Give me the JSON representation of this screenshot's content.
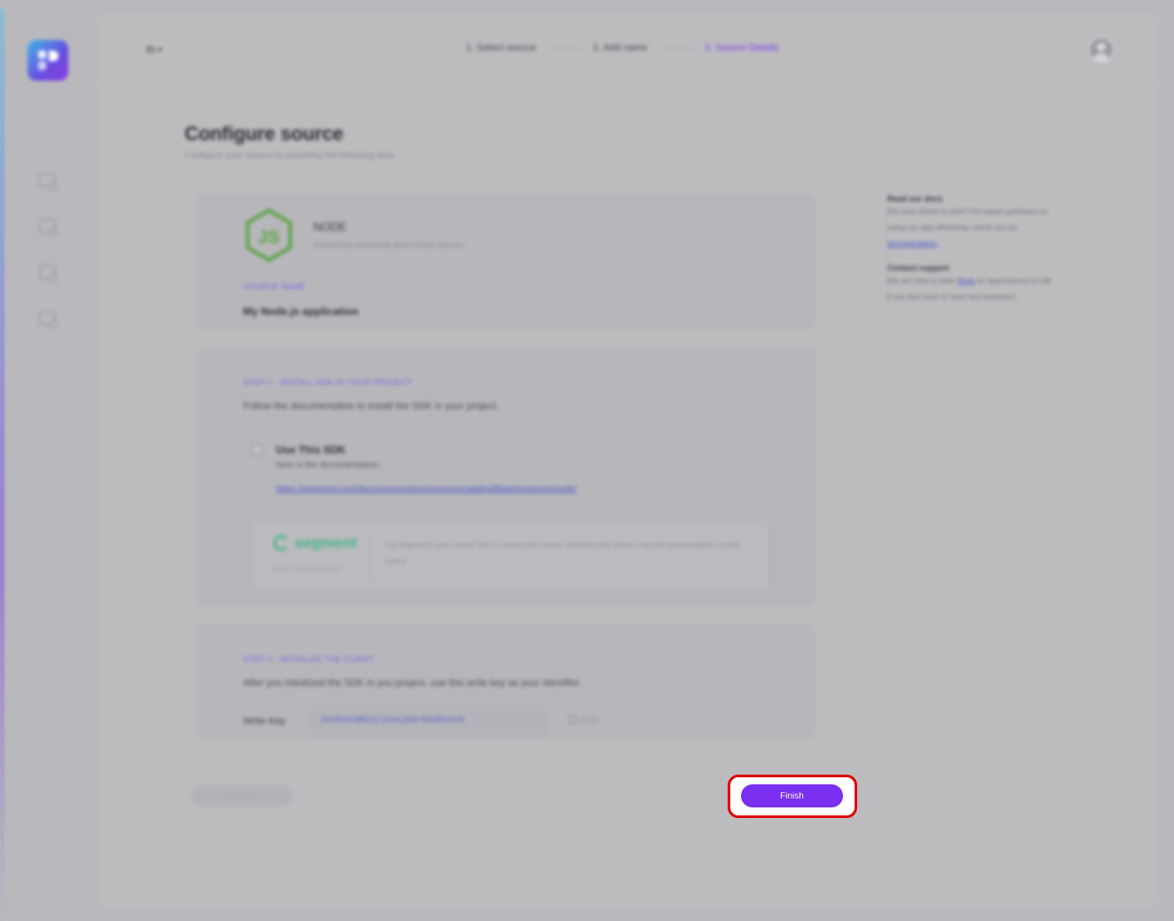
{
  "header": {
    "lang": "th",
    "steps": [
      "1. Select source",
      "2. Add name",
      "3. Source Details"
    ]
  },
  "page": {
    "title": "Configure source",
    "subtitle": "Configure your source by providing the following data."
  },
  "source": {
    "name": "NODE",
    "description": "Something something about Node sources",
    "name_label": "SOURCE NAME",
    "name_value": "My Node.js application"
  },
  "step1": {
    "title": "STEP 1 - INSTALL SDK IN YOUR PROJECT",
    "instruction": "Follow the documentation to install the SDK in your project.",
    "sdk_title": "Use This SDK",
    "sdk_sub": "here is the documentation:",
    "sdk_link": "https://segment.com/docs/connections/sources/catalog/libraries/server/node/",
    "segment_word": "segment",
    "segment_tag": "Active Selected Instance",
    "segment_text": "Use Segment's open source SDK to connect this source. Check the link above to see the documentations for this source."
  },
  "step2": {
    "title": "STEP 2 - INITIALIZE THE CLIENT",
    "instruction": "After you initialized the SDK in you project, use this write key as your identifier.",
    "write_key_label": "Write Key",
    "write_key_value": "2eUheG4BhdjlChajEmrM4d8xXe5",
    "copy_label": "Copy"
  },
  "help": {
    "docs_head": "Read our docs",
    "docs_text_1": "Not sure where to start? For expert guidance on using our app effectively, check out our",
    "docs_link": "documentation",
    "support_head": "Contact support",
    "support_text_1": "We are here to help!",
    "support_link": "Book",
    "support_text_2": "an appointment to talk if you feel stuck or have any questions."
  },
  "footer": {
    "prev_label": "Previous",
    "finish_label": "Finish"
  },
  "colors": {
    "accent": "#7b2ff0",
    "highlight": "#e00000"
  }
}
